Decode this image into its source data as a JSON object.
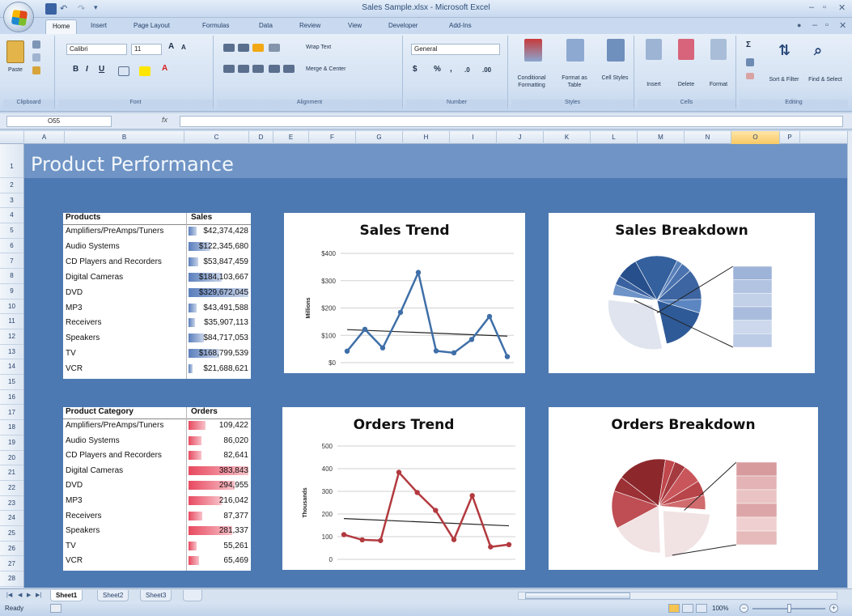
{
  "window": {
    "title": "Sales Sample.xlsx - Microsoft Excel"
  },
  "ribbon": {
    "tabs": [
      "Home",
      "Insert",
      "Page Layout",
      "Formulas",
      "Data",
      "Review",
      "View",
      "Developer",
      "Add-Ins"
    ],
    "active_tab": "Home",
    "groups": {
      "clipboard": {
        "label": "Clipboard",
        "paste": "Paste"
      },
      "font": {
        "label": "Font",
        "font_name": "Calibri",
        "font_size": "11"
      },
      "alignment": {
        "label": "Alignment",
        "wrap_text": "Wrap Text",
        "merge_center": "Merge & Center"
      },
      "number": {
        "label": "Number",
        "format": "General"
      },
      "styles": {
        "label": "Styles",
        "conditional": "Conditional Formatting",
        "format_table": "Format as Table",
        "cell_styles": "Cell Styles"
      },
      "cells": {
        "label": "Cells",
        "insert": "Insert",
        "delete": "Delete",
        "format": "Format"
      },
      "editing": {
        "label": "Editing",
        "sort_filter": "Sort & Filter",
        "find_select": "Find & Select"
      }
    }
  },
  "formula_bar": {
    "name_box": "O55",
    "fx": "fx",
    "value": ""
  },
  "columns": [
    "A",
    "B",
    "C",
    "D",
    "E",
    "F",
    "G",
    "H",
    "I",
    "J",
    "K",
    "L",
    "M",
    "N",
    "O",
    "P"
  ],
  "active_column": "O",
  "rows": [
    "1",
    "2",
    "3",
    "4",
    "5",
    "6",
    "7",
    "8",
    "9",
    "10",
    "11",
    "12",
    "13",
    "14",
    "15",
    "16",
    "17",
    "18",
    "19",
    "20",
    "21",
    "22",
    "23",
    "24",
    "25",
    "26",
    "27",
    "28"
  ],
  "sheet": {
    "title": "Product Performance",
    "sales_table": {
      "header_label": "Products",
      "header_value": "Sales",
      "bar_color": "#5b7fbd",
      "rows": [
        {
          "label": "Amplifiers/PreAmps/Tuners",
          "value": "$42,374,428",
          "level": 0.13
        },
        {
          "label": "Audio Systems",
          "value": "$122,345,680",
          "level": 0.37
        },
        {
          "label": "CD Players and Recorders",
          "value": "$53,847,459",
          "level": 0.16
        },
        {
          "label": "Digital Cameras",
          "value": "$184,103,667",
          "level": 0.56
        },
        {
          "label": "DVD",
          "value": "$329,672,045",
          "level": 1.0
        },
        {
          "label": "MP3",
          "value": "$43,491,588",
          "level": 0.13
        },
        {
          "label": "Receivers",
          "value": "$35,907,113",
          "level": 0.11
        },
        {
          "label": "Speakers",
          "value": "$84,717,053",
          "level": 0.26
        },
        {
          "label": "TV",
          "value": "$168,799,539",
          "level": 0.51
        },
        {
          "label": "VCR",
          "value": "$21,688,621",
          "level": 0.07
        }
      ]
    },
    "orders_table": {
      "header_label": "Product Category",
      "header_value": "Orders",
      "bar_color": "#e8495f",
      "rows": [
        {
          "label": "Amplifiers/PreAmps/Tuners",
          "value": "109,422",
          "level": 0.29
        },
        {
          "label": "Audio Systems",
          "value": "86,020",
          "level": 0.22
        },
        {
          "label": "CD Players and Recorders",
          "value": "82,641",
          "level": 0.22
        },
        {
          "label": "Digital Cameras",
          "value": "383,843",
          "level": 1.0
        },
        {
          "label": "DVD",
          "value": "294,955",
          "level": 0.77
        },
        {
          "label": "MP3",
          "value": "216,042",
          "level": 0.56
        },
        {
          "label": "Receivers",
          "value": "87,377",
          "level": 0.23
        },
        {
          "label": "Speakers",
          "value": "281,337",
          "level": 0.73
        },
        {
          "label": "TV",
          "value": "55,261",
          "level": 0.14
        },
        {
          "label": "VCR",
          "value": "65,469",
          "level": 0.17
        }
      ]
    }
  },
  "chart_data": [
    {
      "type": "line",
      "title": "Sales Trend",
      "ylabel": "Millions",
      "x": [
        1,
        2,
        3,
        4,
        5,
        6,
        7,
        8,
        9,
        10
      ],
      "series": [
        {
          "values": [
            42,
            122,
            54,
            184,
            330,
            43,
            36,
            85,
            169,
            22
          ]
        }
      ],
      "trendline": [
        121,
        97
      ],
      "ylim": [
        0,
        400
      ],
      "yticks": [
        "$0",
        "$100",
        "$200",
        "$300",
        "$400"
      ],
      "grid": true,
      "color": "#3f6fa8"
    },
    {
      "type": "pie",
      "title": "Sales Breakdown",
      "values": [
        42,
        122,
        54,
        184,
        330,
        43,
        36,
        85,
        169,
        22
      ],
      "palette": [
        "#4a73b0",
        "#3d65a2",
        "#5b86c2",
        "#2f5a98",
        "#dfe4ee",
        "#6d93c8",
        "#3a61a0",
        "#274f8c",
        "#34609e",
        "#5880ba"
      ],
      "detail_palette": [
        "#9db3d8",
        "#b3c4e2",
        "#c2d0e8",
        "#a9bcdd",
        "#cdd8ec",
        "#bccbe6"
      ]
    },
    {
      "type": "line",
      "title": "Orders Trend",
      "ylabel": "Thousands",
      "x": [
        1,
        2,
        3,
        4,
        5,
        6,
        7,
        8,
        9,
        10
      ],
      "series": [
        {
          "values": [
            109,
            86,
            83,
            384,
            295,
            216,
            87,
            281,
            55,
            65
          ]
        }
      ],
      "trendline": [
        180,
        148
      ],
      "ylim": [
        0,
        500
      ],
      "yticks": [
        "0",
        "100",
        "200",
        "300",
        "400",
        "500"
      ],
      "grid": true,
      "color": "#b23a3f"
    },
    {
      "type": "pie",
      "title": "Orders Breakdown",
      "values": [
        109,
        86,
        83,
        384,
        295,
        216,
        87,
        281,
        55,
        65
      ],
      "palette": [
        "#c9565b",
        "#b84549",
        "#d06b6e",
        "#a8393e",
        "#f1e2e3",
        "#be4e53",
        "#9b3035",
        "#8c282c",
        "#c0474c",
        "#a53a3f"
      ],
      "detail_palette": [
        "#d79a9d",
        "#e3b3b5",
        "#eac3c4",
        "#dca6a8",
        "#efcfd0",
        "#e6baba"
      ]
    }
  ],
  "sheet_tabs": [
    "Sheet1",
    "Sheet2",
    "Sheet3"
  ],
  "active_sheet": "Sheet1",
  "status": {
    "ready": "Ready",
    "zoom": "100%"
  }
}
